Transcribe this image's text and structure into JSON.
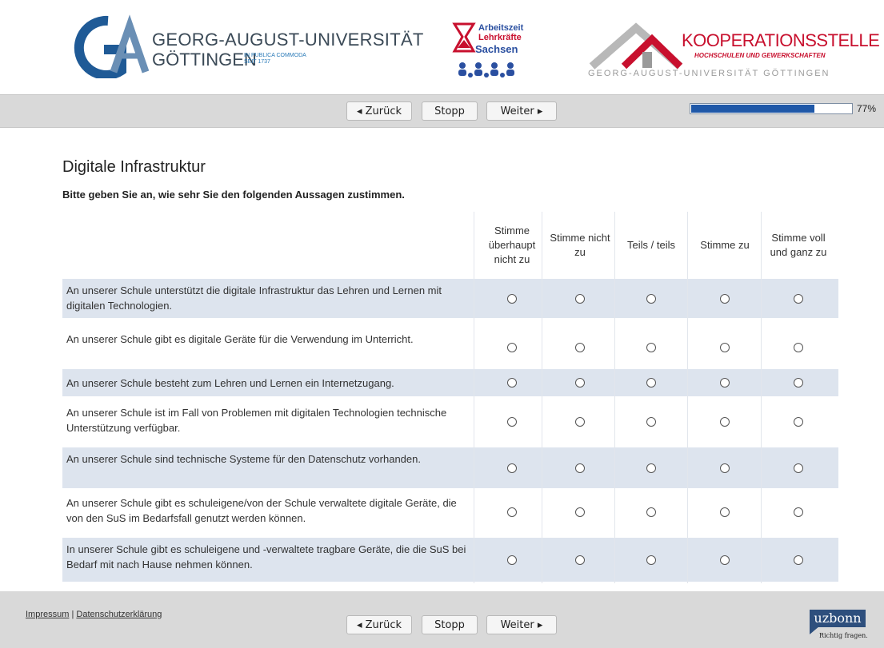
{
  "header": {
    "university_line1": "GEORG-AUGUST-UNIVERSITÄT",
    "university_line2": "GÖTTINGEN",
    "motto_line1": "IN PUBLICA COMMODA",
    "motto_line2": "SEIT 1737",
    "partner_line1": "Arbeitszeit",
    "partner_line2": "Lehrkräfte",
    "partner_line3": "Sachsen",
    "koop_title": "KOOPERATIONSSTELLE",
    "koop_subtitle": "HOCHSCHULEN UND GEWERKSCHAFTEN",
    "koop_bottom": "GEORG-AUGUST-UNIVERSITÄT GÖTTINGEN"
  },
  "nav": {
    "back_label": "◂ Zurück",
    "stop_label": "Stopp",
    "next_label": "Weiter ▸",
    "progress_fraction": 0.77,
    "progress_text": "77%"
  },
  "page": {
    "title": "Digitale Infrastruktur",
    "instruction": "Bitte geben Sie an, wie sehr Sie den folgenden Aussagen zustimmen."
  },
  "scale": [
    "Stimme überhaupt nicht zu",
    "Stimme nicht zu",
    "Teils / teils",
    "Stimme zu",
    "Stimme voll und ganz zu"
  ],
  "items": [
    "An unserer Schule unterstützt die digitale Infrastruktur das Lehren und Lernen mit digitalen Technologien.",
    "An unserer Schule gibt es digitale Geräte für die Verwendung im Unterricht.",
    "An unserer Schule besteht zum Lehren und Lernen ein Internetzugang.",
    "An unserer Schule ist im Fall von Problemen mit digitalen Technologien technische Unterstützung verfügbar.",
    "An unserer Schule sind technische Systeme für den Datenschutz vorhanden.",
    "An unserer Schule gibt es schuleigene/von der Schule verwaltete digitale Geräte, die von den SuS im Bedarfsfall genutzt werden können.",
    "In unserer Schule gibt es schuleigene und -verwaltete tragbare Geräte, die die SuS bei Bedarf mit nach Hause nehmen können."
  ],
  "footer": {
    "impressum": "Impressum",
    "separator": " | ",
    "datenschutz": "Datenschutzerklärung",
    "brand": "uzbonn",
    "brand_tagline": "Richtig fragen."
  },
  "colors": {
    "nav_bg": "#d9d9d9",
    "row_alt": "#dde4ee",
    "progress": "#1f58a8",
    "brand_blue": "#2e4f7d",
    "koop_red": "#c8102e"
  }
}
